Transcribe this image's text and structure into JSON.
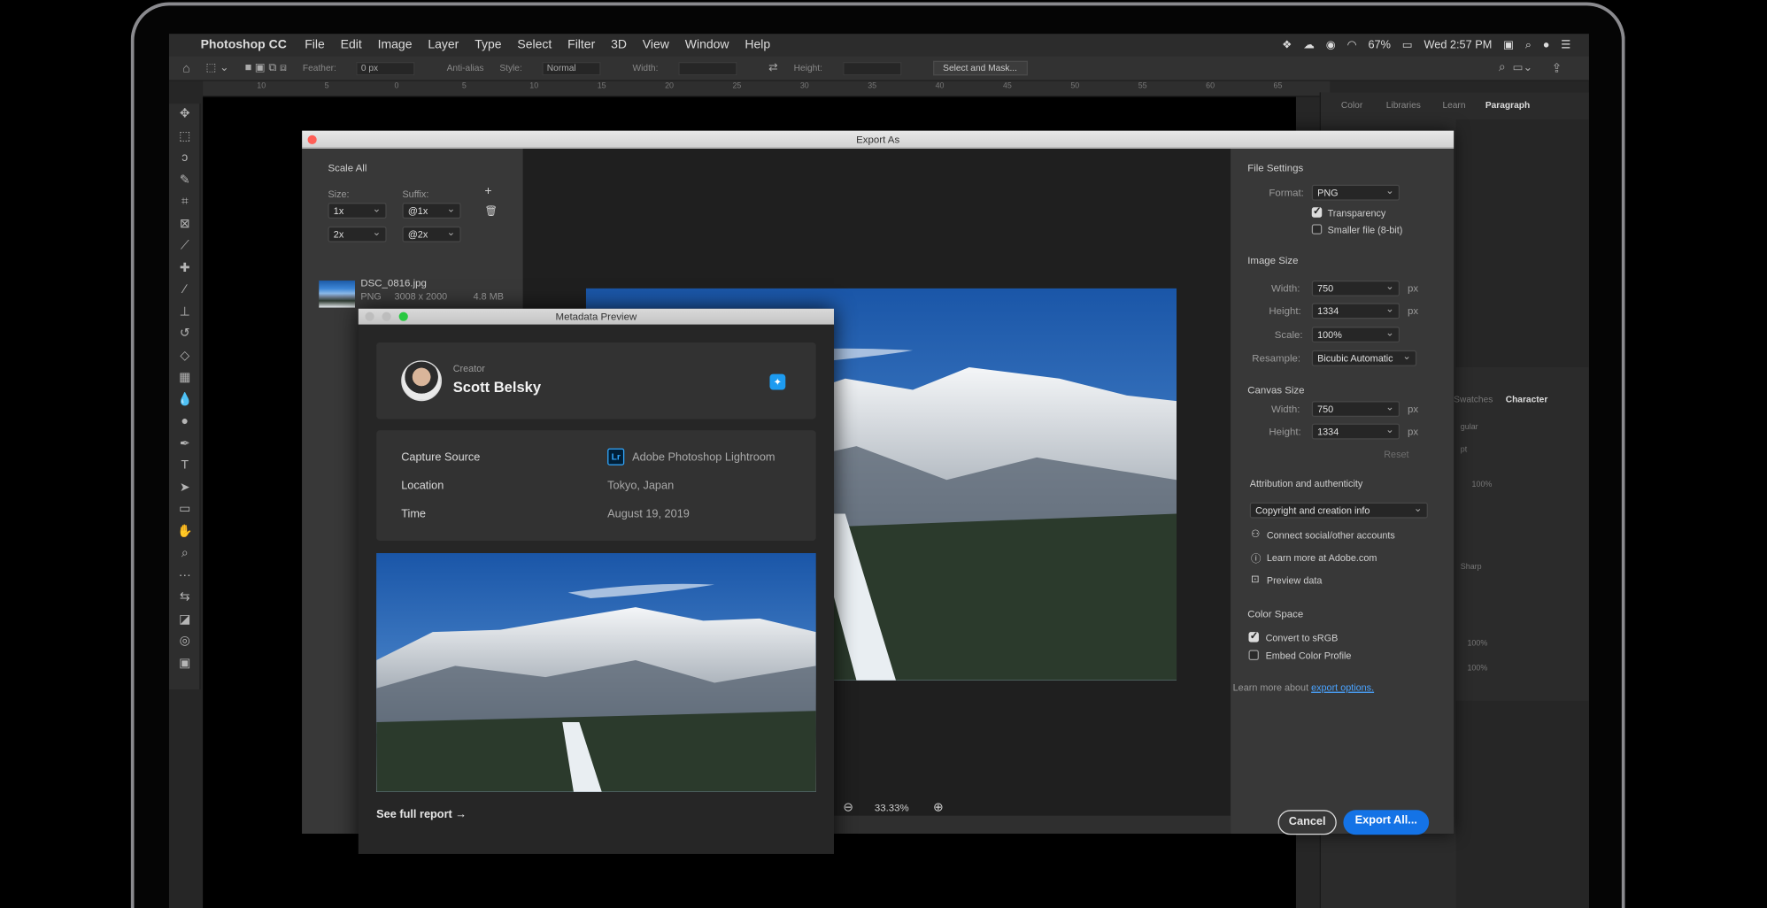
{
  "menubar": {
    "app_name": "Photoshop CC",
    "menus": [
      "File",
      "Edit",
      "Image",
      "Layer",
      "Type",
      "Select",
      "Filter",
      "3D",
      "View",
      "Window",
      "Help"
    ],
    "battery": "67%",
    "clock": "Wed 2:57 PM"
  },
  "optbar": {
    "feather_label": "Feather:",
    "feather_value": "0 px",
    "antialias": "Anti-alias",
    "style_label": "Style:",
    "style_value": "Normal",
    "width_label": "Width:",
    "height_label": "Height:",
    "select_mask": "Select and Mask..."
  },
  "ruler": [
    "10",
    "5",
    "0",
    "5",
    "10",
    "15",
    "20",
    "25",
    "30",
    "35",
    "40",
    "45",
    "50",
    "55",
    "60",
    "65"
  ],
  "rpanel": {
    "tabs": [
      "Color",
      "Libraries",
      "Learn",
      "Paragraph"
    ],
    "lower_tabs": [
      "Swatches",
      "Character"
    ],
    "char_fields": {
      "size_pct": "100%",
      "opacity": "100%",
      "fill": "100%",
      "aa": "Sharp",
      "style": "gular",
      "pt": "pt"
    }
  },
  "dialog": {
    "title": "Export As",
    "scale_all": "Scale All",
    "size_label": "Size:",
    "suffix_label": "Suffix:",
    "rows": [
      {
        "size": "1x",
        "suffix": "@1x"
      },
      {
        "size": "2x",
        "suffix": "@2x"
      }
    ],
    "file": {
      "name": "DSC_0816.jpg",
      "format": "PNG",
      "dims": "3008 x 2000",
      "size": "4.8 MB"
    },
    "zoom": "33.33%",
    "file_settings": {
      "heading": "File Settings",
      "format_label": "Format:",
      "format_value": "PNG",
      "transparency": "Transparency",
      "smaller": "Smaller file (8-bit)"
    },
    "image_size": {
      "heading": "Image Size",
      "width_label": "Width:",
      "width": "750",
      "height_label": "Height:",
      "height": "1334",
      "scale_label": "Scale:",
      "scale": "100%",
      "resample_label": "Resample:",
      "resample": "Bicubic Automatic",
      "unit": "px"
    },
    "canvas_size": {
      "heading": "Canvas Size",
      "width_label": "Width:",
      "width": "750",
      "height_label": "Height:",
      "height": "1334",
      "unit": "px",
      "reset": "Reset"
    },
    "attribution": {
      "heading": "Attribution and authenticity",
      "dropdown": "Copyright and creation info",
      "connect": "Connect social/other accounts",
      "learn": "Learn more at Adobe.com",
      "preview": "Preview data"
    },
    "color_space": {
      "heading": "Color Space",
      "srgb": "Convert to sRGB",
      "embed": "Embed Color Profile"
    },
    "learn_more_prefix": "Learn more about",
    "learn_more_link": "export options.",
    "cancel": "Cancel",
    "export_all": "Export All..."
  },
  "metadata": {
    "title": "Metadata Preview",
    "creator_label": "Creator",
    "creator_name": "Scott Belsky",
    "capture_label": "Capture Source",
    "capture_badge": "Lr",
    "capture_value": "Adobe Photoshop Lightroom",
    "location_label": "Location",
    "location_value": "Tokyo, Japan",
    "time_label": "Time",
    "time_value": "August 19, 2019",
    "full_report": "See full report →"
  }
}
